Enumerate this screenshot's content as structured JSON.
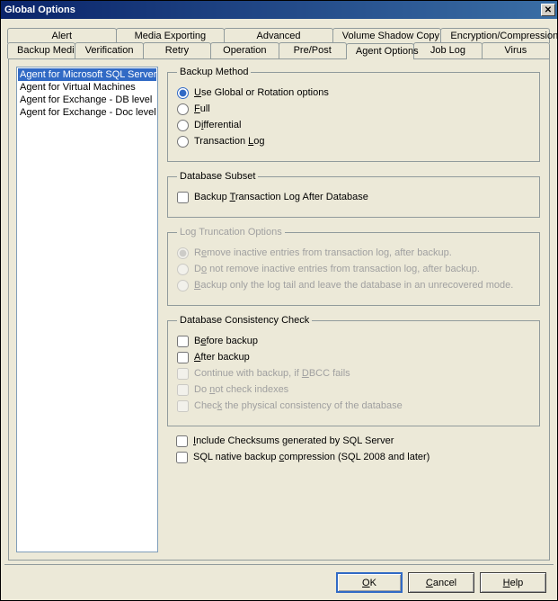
{
  "window": {
    "title": "Global Options"
  },
  "tabs_row1": [
    {
      "label": "Alert"
    },
    {
      "label": "Media Exporting"
    },
    {
      "label": "Advanced"
    },
    {
      "label": "Volume Shadow Copy Service"
    },
    {
      "label": "Encryption/Compression"
    }
  ],
  "tabs_row2": [
    {
      "label": "Backup Media"
    },
    {
      "label": "Verification"
    },
    {
      "label": "Retry"
    },
    {
      "label": "Operation"
    },
    {
      "label": "Pre/Post"
    },
    {
      "label": "Agent Options",
      "active": true
    },
    {
      "label": "Job Log"
    },
    {
      "label": "Virus"
    }
  ],
  "agents": [
    {
      "label": "Agent for Microsoft SQL Server",
      "selected": true
    },
    {
      "label": "Agent for Virtual Machines"
    },
    {
      "label": "Agent for Exchange - DB level"
    },
    {
      "label": "Agent for Exchange - Doc level"
    }
  ],
  "groups": {
    "backup_method": {
      "legend": "Backup Method",
      "options": [
        {
          "pre": "",
          "key": "U",
          "post": "se Global or Rotation options",
          "checked": true
        },
        {
          "pre": "",
          "key": "F",
          "post": "ull"
        },
        {
          "pre": "D",
          "key": "i",
          "post": "fferential"
        },
        {
          "pre": "Transaction ",
          "key": "L",
          "post": "og"
        }
      ]
    },
    "db_subset": {
      "legend": "Database Subset",
      "opt": {
        "pre": "Backup ",
        "key": "T",
        "post": "ransaction Log After Database"
      }
    },
    "log_trunc": {
      "legend": "Log Truncation Options",
      "options": [
        {
          "pre": "R",
          "key": "e",
          "post": "move inactive entries from transaction log, after backup.",
          "checked": true
        },
        {
          "pre": "D",
          "key": "o",
          "post": " not remove inactive entries from transaction log, after backup."
        },
        {
          "pre": "",
          "key": "B",
          "post": "ackup only the log tail and leave the database in an unrecovered mode."
        }
      ]
    },
    "dbcc": {
      "legend": "Database Consistency Check",
      "options": [
        {
          "pre": "B",
          "key": "e",
          "post": "fore backup",
          "enabled": true
        },
        {
          "pre": "",
          "key": "A",
          "post": "fter backup",
          "enabled": true
        },
        {
          "pre": "Continue with backup, if ",
          "key": "D",
          "post": "BCC fails",
          "enabled": false
        },
        {
          "pre": "Do ",
          "key": "n",
          "post": "ot check indexes",
          "enabled": false
        },
        {
          "pre": "Chec",
          "key": "k",
          "post": " the physical consistency of the database",
          "enabled": false
        }
      ]
    },
    "extra": [
      {
        "pre": "",
        "key": "I",
        "post": "nclude Checksums generated by SQL Server"
      },
      {
        "pre": "SQL native backup ",
        "key": "c",
        "post": "ompression (SQL 2008 and later)"
      }
    ]
  },
  "buttons": {
    "ok": {
      "pre": "",
      "key": "O",
      "post": "K"
    },
    "cancel": {
      "pre": "",
      "key": "C",
      "post": "ancel"
    },
    "help": {
      "pre": "",
      "key": "H",
      "post": "elp"
    }
  }
}
